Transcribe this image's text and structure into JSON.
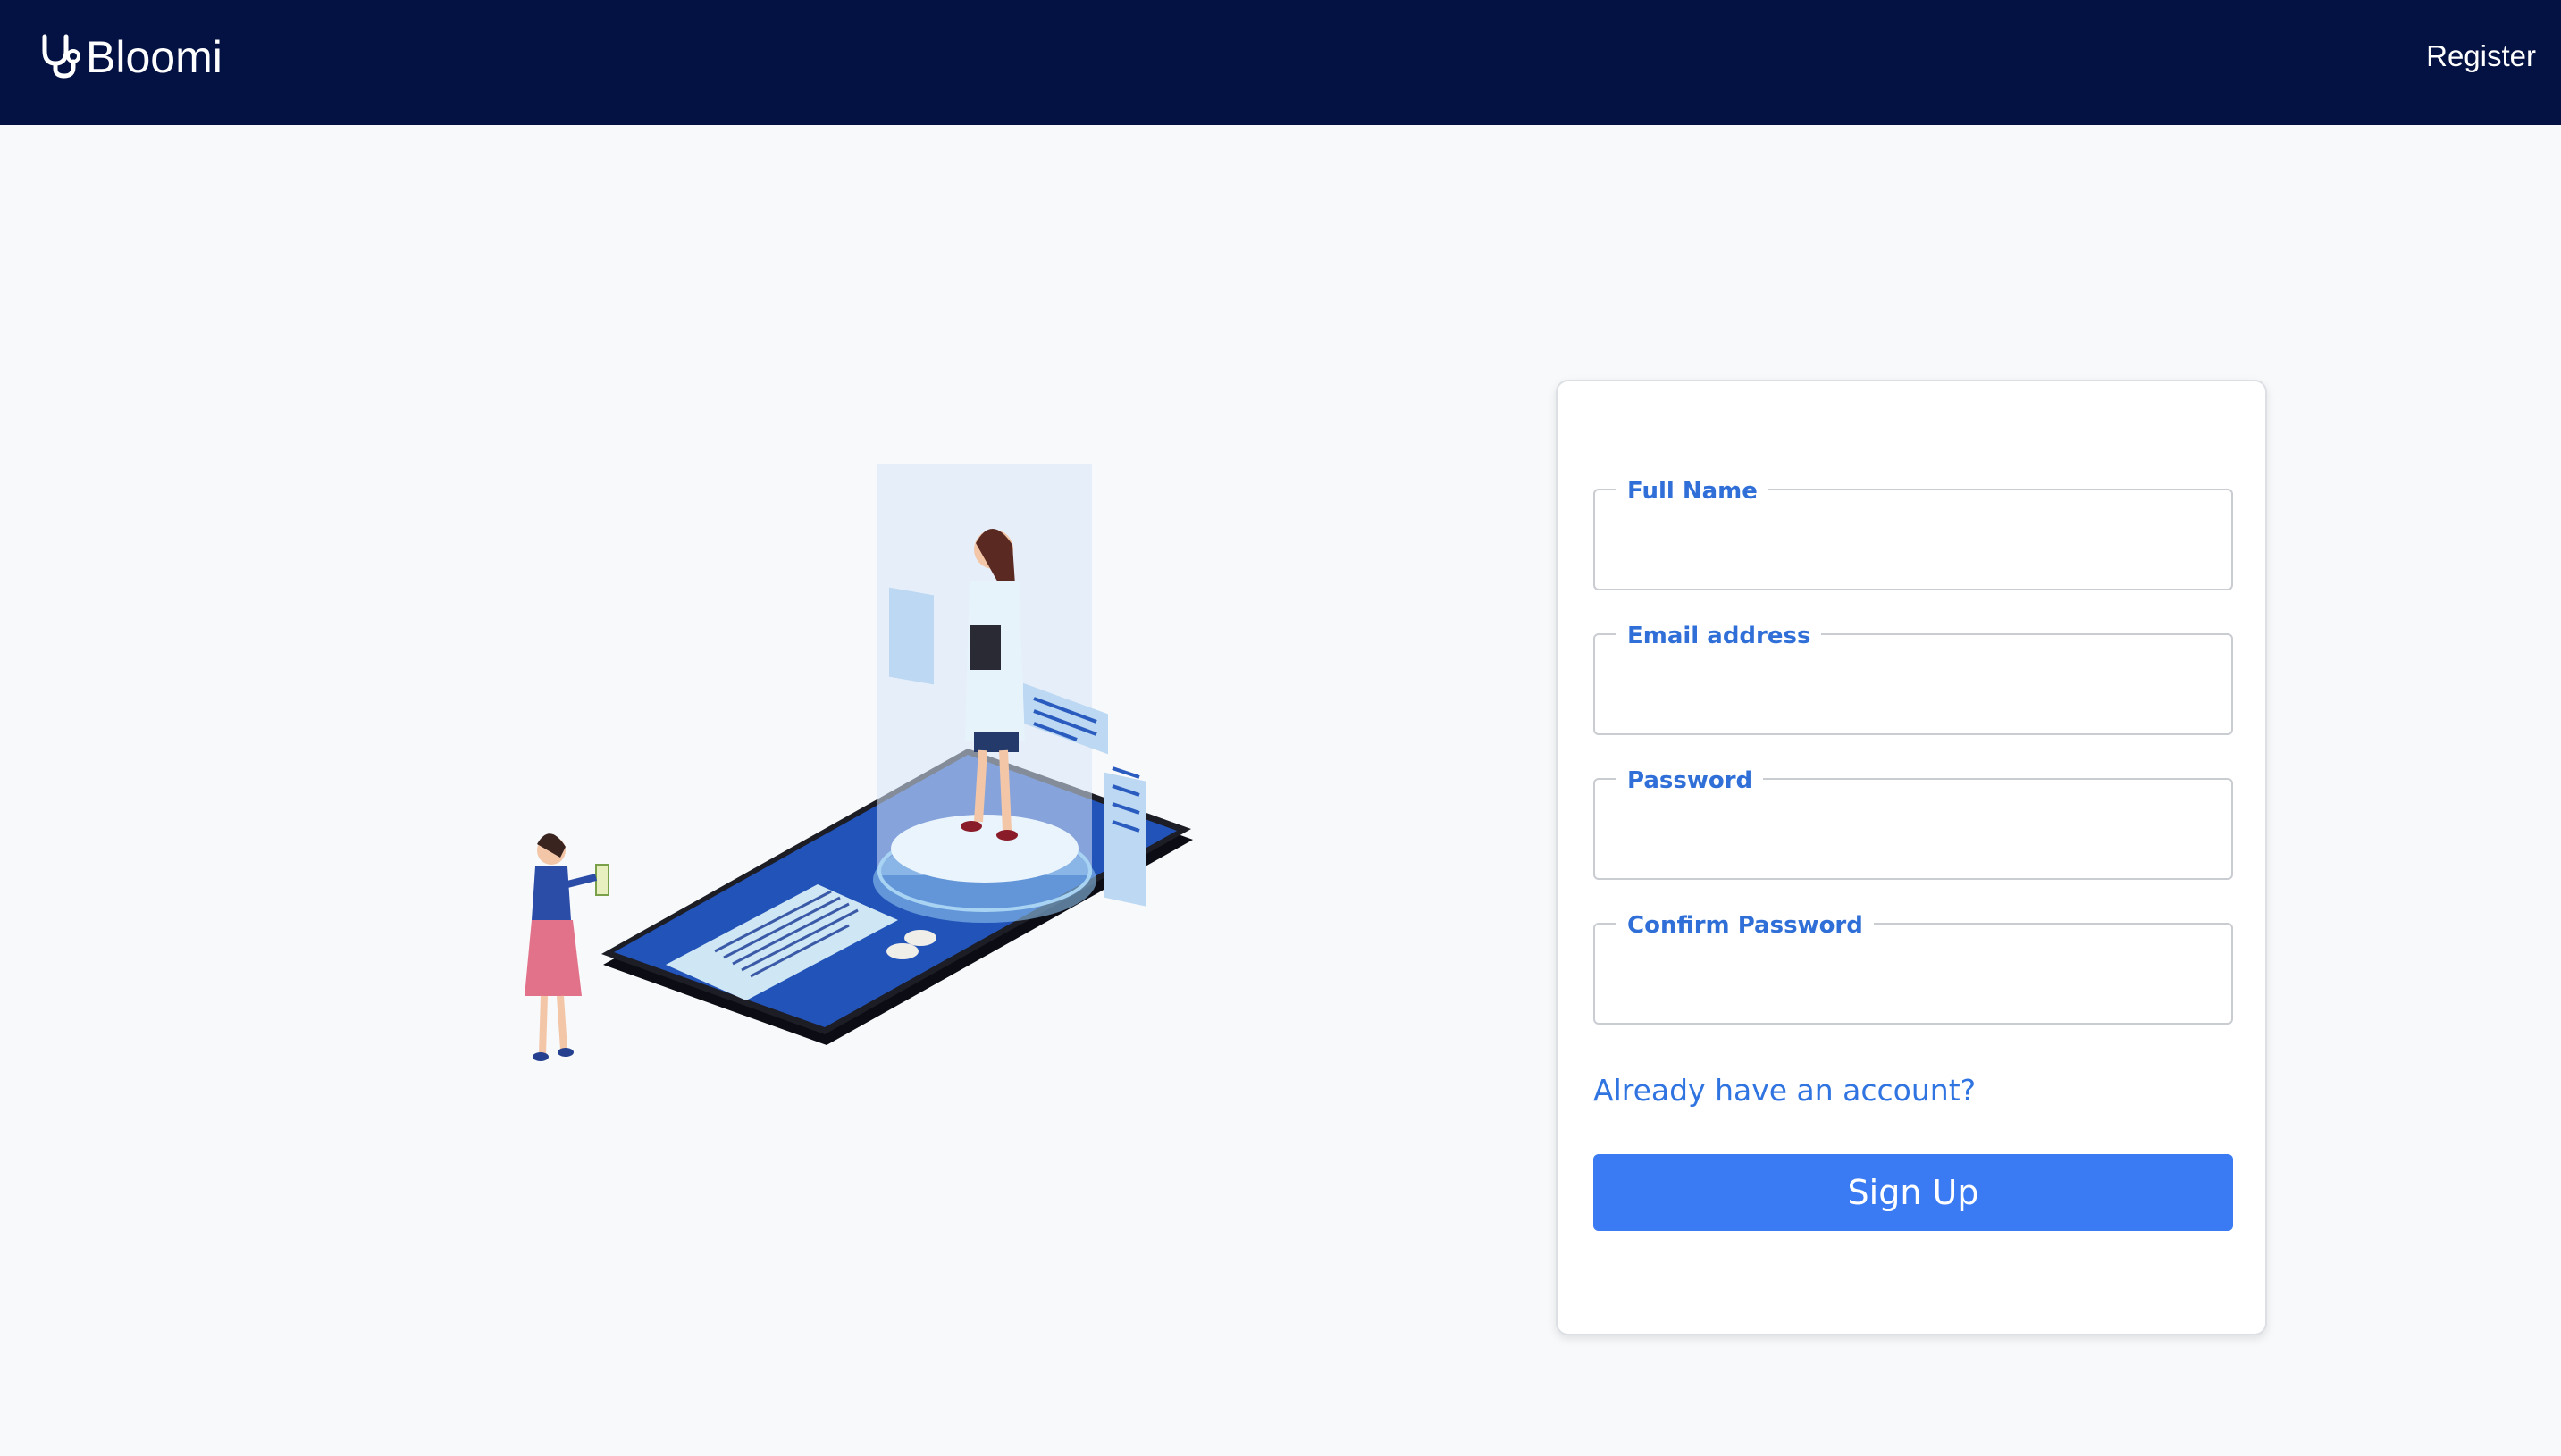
{
  "navbar": {
    "brand_name": "Bloomi",
    "brand_icon": "stethoscope-icon",
    "nav_link": "Register",
    "background": "#041243"
  },
  "form": {
    "fields": [
      {
        "label": "Full Name",
        "value": ""
      },
      {
        "label": "Email address",
        "value": ""
      },
      {
        "label": "Password",
        "value": ""
      },
      {
        "label": "Confirm Password",
        "value": ""
      }
    ],
    "login_link": "Already have an account?",
    "submit_label": "Sign Up",
    "accent": "#3a7af2",
    "label_color": "#2f6fd7"
  },
  "illustration": {
    "icon": "telemedicine-phone-illustration"
  }
}
